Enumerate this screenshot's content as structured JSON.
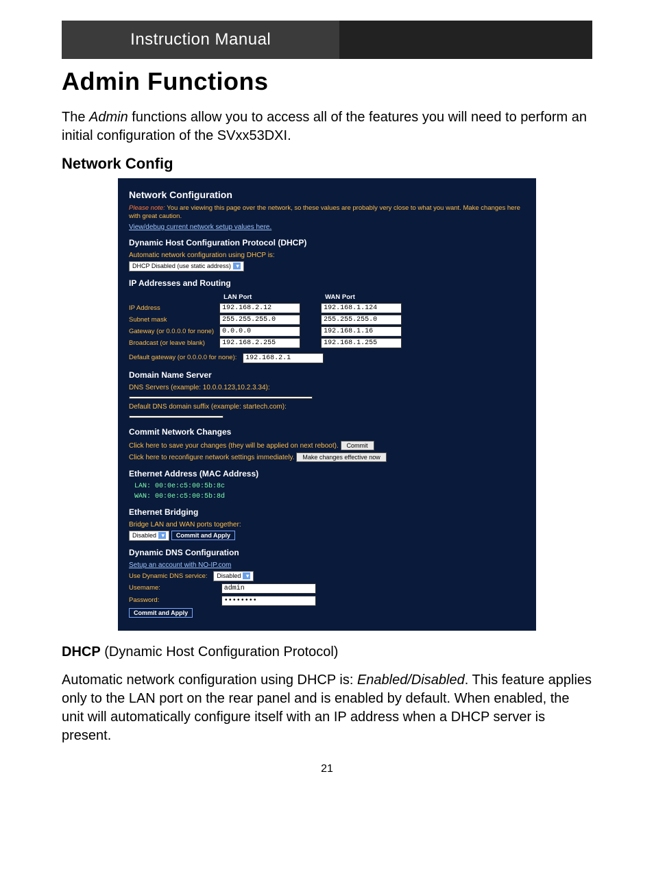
{
  "header": {
    "title": "Instruction Manual"
  },
  "section_title": "Admin Functions",
  "intro": {
    "pre": "The ",
    "em": "Admin",
    "post": " functions allow you to access all of the features you will need to perform an initial configuration of the SVxx53DXI."
  },
  "subheading": "Network Config",
  "shot": {
    "h_netconf": "Network Configuration",
    "note_em": "Please note:",
    "note_rest": " You are viewing this page over the network, so these values are probably very close to what you want. Make changes here with great caution.",
    "link_debug": "View/debug current network setup values here.",
    "h_dhcp": "Dynamic Host Configuration Protocol (DHCP)",
    "dhcp_label": "Automatic network configuration using DHCP is:",
    "dhcp_select": "DHCP Disabled (use static address)",
    "h_iproute": "IP Addresses and Routing",
    "col_lan": "LAN Port",
    "col_wan": "WAN Port",
    "rows": {
      "ipaddr": {
        "label": "IP Address",
        "lan": "192.168.2.12",
        "wan": "192.168.1.124"
      },
      "subnet": {
        "label": "Subnet mask",
        "lan": "255.255.255.0",
        "wan": "255.255.255.0"
      },
      "gateway": {
        "label": "Gateway (or 0.0.0.0 for none)",
        "lan": "0.0.0.0",
        "wan": "192.168.1.16"
      },
      "bcast": {
        "label": "Broadcast (or leave blank)",
        "lan": "192.168.2.255",
        "wan": "192.168.1.255"
      }
    },
    "defgw_label": "Default gateway (or 0.0.0.0 for none):",
    "defgw_val": "192.168.2.1",
    "h_dns": "Domain Name Server",
    "dns_servers_label": "DNS Servers (example: 10.0.0.123,10.2.3.34):",
    "dns_servers_val": "",
    "dns_suffix_label": "Default DNS domain suffix (example: startech.com):",
    "dns_suffix_val": "",
    "h_commit": "Commit Network Changes",
    "commit_line1": "Click here to save your changes (they will be applied on next reboot).",
    "commit_btn": "Commit",
    "commit_line2": "Click here to reconfigure network settings immediately.",
    "commit_btn2": "Make changes effective now",
    "h_mac": "Ethernet Address (MAC Address)",
    "mac_lan": "LAN: 00:0e:c5:00:5b:8c",
    "mac_wan": "WAN: 00:0e:c5:00:5b:8d",
    "h_bridge": "Ethernet Bridging",
    "bridge_label": "Bridge LAN and WAN ports together:",
    "bridge_sel": "Disabled",
    "bridge_btn": "Commit and Apply",
    "h_ddns": "Dynamic DNS Configuration",
    "ddns_link": "Setup an account with NO-IP.com",
    "ddns_use_label": "Use Dynamic DNS service:",
    "ddns_sel": "Disabled",
    "ddns_user_label": "Usemame:",
    "ddns_user_val": "admin",
    "ddns_pass_label": "Password:",
    "ddns_pass_val": "••••••••",
    "ddns_btn": "Commit and Apply"
  },
  "dhcp_para": {
    "bold": "DHCP",
    "rest1": " (Dynamic Host Configuration Protocol)",
    "line2a": "Automatic network configuration using DHCP is: ",
    "line2em": "Enabled/Disabled",
    "line2b": ". This feature applies only to the LAN port on the rear panel and is enabled by default.  When enabled, the unit will automatically configure itself with an IP address when a DHCP server is present."
  },
  "page_number": "21"
}
